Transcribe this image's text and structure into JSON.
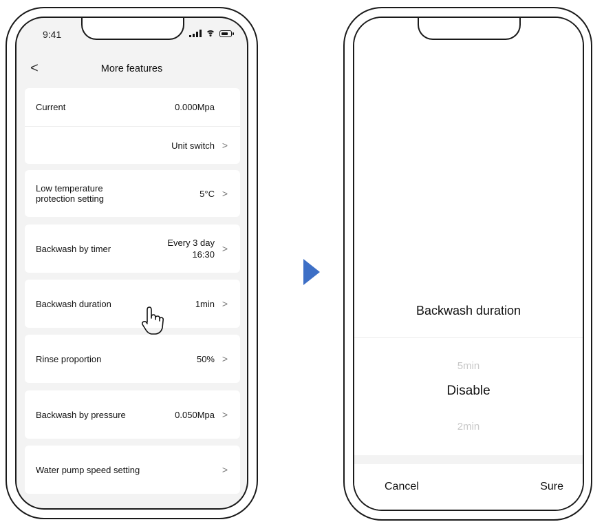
{
  "left_screen": {
    "status_time": "9:41",
    "back_glyph": "<",
    "title": "More features",
    "cards": [
      [
        {
          "label": "Current",
          "value": "0.000Mpa",
          "chevron": ""
        },
        {
          "label": "",
          "value": "Unit switch",
          "chevron": ">"
        }
      ],
      [
        {
          "label": "Low temperature\nprotection setting",
          "value": "5°C",
          "chevron": ">"
        }
      ],
      [
        {
          "label": "Backwash by timer",
          "value": "Every 3 day\n16:30",
          "chevron": ">"
        }
      ],
      [
        {
          "label": "Backwash duration",
          "value": "1min",
          "chevron": ">"
        }
      ],
      [
        {
          "label": "Rinse proportion",
          "value": "50%",
          "chevron": ">"
        }
      ],
      [
        {
          "label": "Backwash by pressure",
          "value": "0.050Mpa",
          "chevron": ">"
        }
      ],
      [
        {
          "label": "Water pump speed setting",
          "value": "",
          "chevron": ">"
        }
      ]
    ]
  },
  "right_screen": {
    "sheet_title": "Backwash duration",
    "picker": {
      "prev": "5min",
      "selected": "Disable",
      "next": "2min"
    },
    "cancel_label": "Cancel",
    "sure_label": "Sure"
  },
  "colors": {
    "arrow": "#3d6fc6",
    "background": "#f3f3f3"
  }
}
